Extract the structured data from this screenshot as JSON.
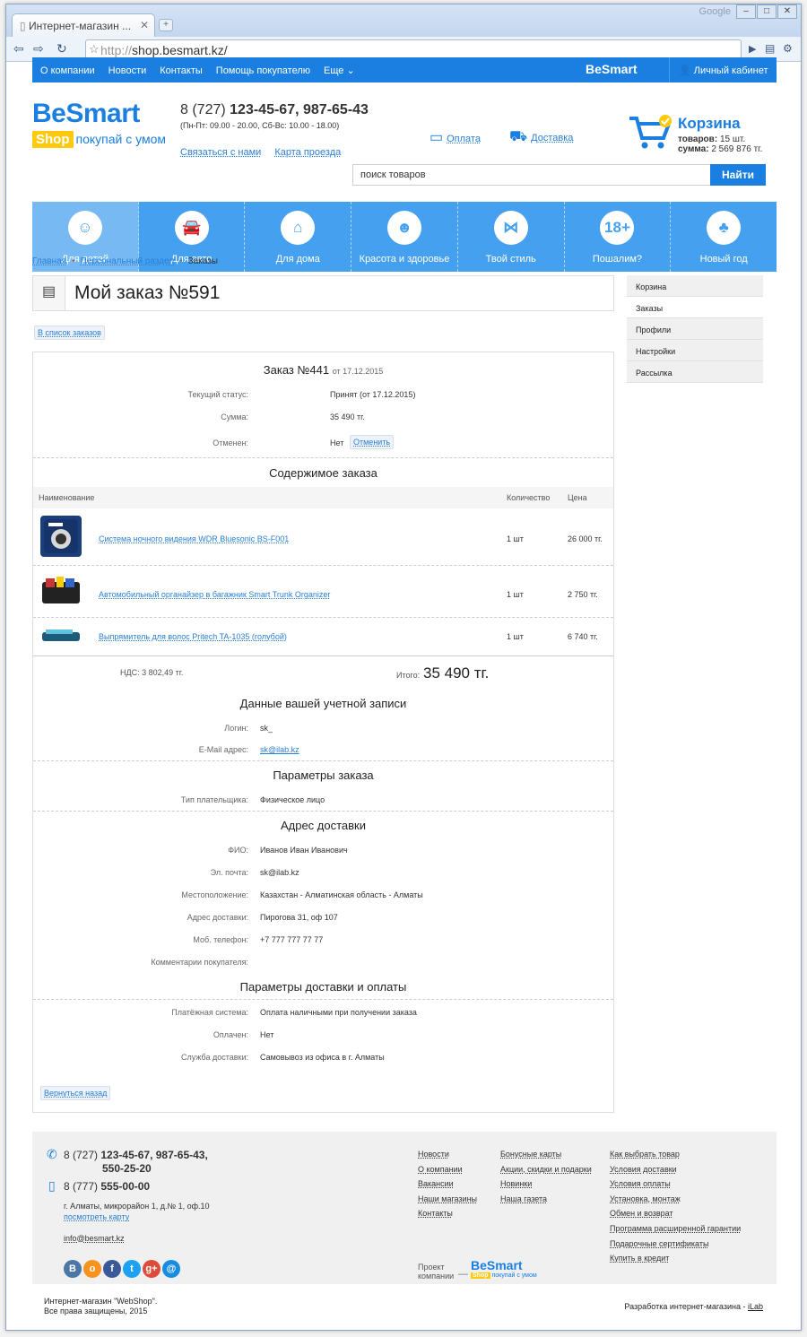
{
  "browser": {
    "tab_title": "Интернет-магазин ...",
    "google_label": "Google",
    "url_proto": "http://",
    "url_host": "shop.besmart.kz/"
  },
  "topnav": {
    "links": [
      "О компании",
      "Новости",
      "Контакты",
      "Помощь покупателю",
      "Еще"
    ],
    "brand": "BeSmart",
    "cabinet": "Личный кабинет"
  },
  "header": {
    "logo_main": "BeSmart",
    "logo_shop": "Shop",
    "logo_slogan": "покупай с умом",
    "phone_prefix": "8 (727)",
    "phone_numbers": "123-45-67, 987-65-43",
    "hours": "(Пн-Пт: 09.00 - 20.00, Сб-Вс: 10.00 - 18.00)",
    "link_contact": "Связаться с нами",
    "link_map": "Карта проезда",
    "payment": "Оплата",
    "delivery": "Доставка",
    "cart_title": "Корзина",
    "cart_items_label": "товаров:",
    "cart_items_value": "15 шт.",
    "cart_sum_label": "сумма:",
    "cart_sum_value": "2 569 876 тг.",
    "search_value": "поиск товаров",
    "search_button": "Найти"
  },
  "categories": [
    {
      "label": "Для детей",
      "icon": "☺"
    },
    {
      "label": "Для авто",
      "icon": "🚘"
    },
    {
      "label": "Для дома",
      "icon": "⌂"
    },
    {
      "label": "Красота и здоровье",
      "icon": "☻"
    },
    {
      "label": "Твой стиль",
      "icon": "⋈"
    },
    {
      "label": "Пошалим?",
      "icon": "18+"
    },
    {
      "label": "Новый год",
      "icon": "♣"
    }
  ],
  "breadcrumb": [
    "Главная",
    "Персональный раздел",
    "Заказы"
  ],
  "page_title": "Мой заказ №591",
  "back_to_list": "В список заказов",
  "order": {
    "title": "Заказ №441",
    "title_date": "от 17.12.2015",
    "status_label": "Текущий статус:",
    "status_value": "Принят (от 17.12.2015)",
    "sum_label": "Сумма:",
    "sum_value": "35 490 тг.",
    "cancelled_label": "Отменен:",
    "cancelled_value": "Нет",
    "cancel_button": "Отменить",
    "contents_title": "Содержимое заказа",
    "col_name": "Наименование",
    "col_qty": "Количество",
    "col_price": "Цена",
    "items": [
      {
        "name": "Система ночного видения WDR Bluesonic BS-F001",
        "qty": "1 шт",
        "price": "26 000 тг."
      },
      {
        "name": "Автомобильный органайзер в багажник Smart Trunk Organizer",
        "qty": "1 шт",
        "price": "2 750 тг."
      },
      {
        "name": "Выпрямитель для волос Pritech TA-1035 (голубой)",
        "qty": "1 шт",
        "price": "6 740 тг."
      }
    ],
    "vat": "НДС: 3 802,49 тг.",
    "total_label": "Итого:",
    "total_value": "35 490 тг.",
    "account_title": "Данные вашей учетной записи",
    "login_label": "Логин:",
    "login_value": "sk_",
    "email_label": "E-Mail адрес:",
    "email_value": "sk@ilab.kz",
    "params_title": "Параметры заказа",
    "payer_label": "Тип плательщика:",
    "payer_value": "Физическое лицо",
    "address_title": "Адрес доставки",
    "fio_label": "ФИО:",
    "fio_value": "Иванов Иван Иванович",
    "mail_label": "Эл. почта:",
    "mail_value": "sk@ilab.kz",
    "location_label": "Местоположение:",
    "location_value": "Казахстан - Алматинская область - Алматы",
    "addr_label": "Адрес доставки:",
    "addr_value": "Пирогова 31, оф 107",
    "mobile_label": "Моб. телефон:",
    "mobile_value": "+7 777 777 77 77",
    "comments_label": "Комментарии покупателя:",
    "delpay_title": "Параметры доставки и оплаты",
    "paysys_label": "Платёжная система:",
    "paysys_value": "Оплата наличными при получении заказа",
    "paid_label": "Оплачен:",
    "paid_value": "Нет",
    "service_label": "Служба доставки:",
    "service_value": "Самовывоз из офиса в г. Алматы",
    "back_button": "Вернуться назад"
  },
  "sidebar": [
    "Корзина",
    "Заказы",
    "Профили",
    "Настройки",
    "Рассылка"
  ],
  "footer": {
    "phone1_prefix": "8 (727)",
    "phone1": "123-45-67, 987-65-43,",
    "phone1b": "550-25-20",
    "phone2_prefix": "8 (777)",
    "phone2": "555-00-00",
    "address": "г. Алматы, микрорайон 1, д.№ 1, оф.10",
    "map_link": "посмотреть карту",
    "email": "info@besmart.kz",
    "col1": [
      "Новости",
      "О компании",
      "Вакансии",
      "Наши магазины",
      "Контакты"
    ],
    "col2": [
      "Бонусные карты",
      "Акции, скидки и подарки",
      "Новинки",
      "Наша газета"
    ],
    "col3": [
      "Как выбрать товар",
      "Условия доставки",
      "Условия оплаты",
      "Установка, монтаж",
      "Обмен и возврат",
      "Программа расширенной гарантии",
      "Подарочные сертификаты",
      "Купить в кредит"
    ],
    "project_label_1": "Проект",
    "project_label_2": "компании",
    "project_logo": "BeSmart",
    "project_shop": "Shop",
    "project_slogan": "покупай с умом",
    "social": [
      {
        "icon": "vk-icon",
        "glyph": "В",
        "color": "#4a76a8"
      },
      {
        "icon": "ok-icon",
        "glyph": "о",
        "color": "#f7931e"
      },
      {
        "icon": "facebook-icon",
        "glyph": "f",
        "color": "#3b5998"
      },
      {
        "icon": "twitter-icon",
        "glyph": "t",
        "color": "#1da1f2"
      },
      {
        "icon": "googleplus-icon",
        "glyph": "g+",
        "color": "#dd4b39"
      },
      {
        "icon": "mail-icon",
        "glyph": "@",
        "color": "#168de2"
      }
    ]
  },
  "bottom": {
    "copyright_1": "Интернет-магазин \"WebShop\".",
    "copyright_2": "Все права защищены, 2015",
    "dev_text": "Разработка интернет-магазина -",
    "dev_link": "iLab"
  }
}
